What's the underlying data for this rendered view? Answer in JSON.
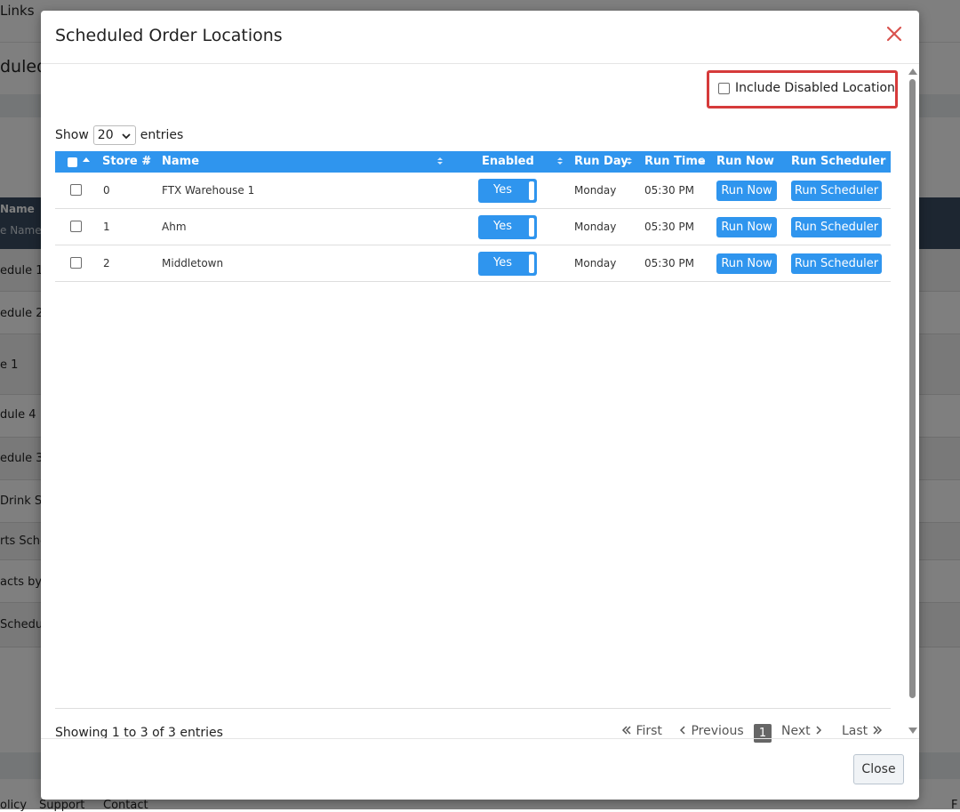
{
  "background": {
    "nav_link": "Links",
    "heading_fragment": "duled",
    "col_header": "Name",
    "filter_placeholder": "e Name",
    "rows": [
      "edule 1",
      "edule 2",
      "e 1",
      "dule 4",
      "edule 3",
      "Drink Sche",
      "rts Sche",
      "acts by A",
      "Schedul"
    ],
    "footer_links": [
      "olicy",
      "Support",
      "Contact"
    ],
    "footer_right": "F"
  },
  "modal": {
    "title": "Scheduled Order Locations",
    "include_disabled_label": "Include Disabled Location",
    "include_disabled_checked": false,
    "show_label": "Show",
    "entries_value": "20",
    "entries_label": "entries",
    "columns": {
      "store": "Store #",
      "name": "Name",
      "enabled": "Enabled",
      "run_day": "Run Day",
      "run_time": "Run Time",
      "run_now": "Run Now",
      "run_scheduler": "Run Scheduler"
    },
    "rows": [
      {
        "store": "0",
        "name": "FTX Warehouse 1",
        "enabled": "Yes",
        "run_day": "Monday",
        "run_time": "05:30 PM",
        "run_now": "Run Now",
        "run_scheduler": "Run Scheduler"
      },
      {
        "store": "1",
        "name": "Ahm",
        "enabled": "Yes",
        "run_day": "Monday",
        "run_time": "05:30 PM",
        "run_now": "Run Now",
        "run_scheduler": "Run Scheduler"
      },
      {
        "store": "2",
        "name": "Middletown",
        "enabled": "Yes",
        "run_day": "Monday",
        "run_time": "05:30 PM",
        "run_now": "Run Now",
        "run_scheduler": "Run Scheduler"
      }
    ],
    "info": "Showing 1 to 3 of 3 entries",
    "pagination": {
      "first": "First",
      "previous": "Previous",
      "current_page": "1",
      "next": "Next",
      "last": "Last"
    },
    "close_label": "Close"
  },
  "colors": {
    "accent": "#2f95ee",
    "highlight_border": "#d63b3b",
    "close_icon": "#d9534f"
  },
  "icons": [
    "close-icon",
    "sort-icon",
    "double-chevron-left-icon",
    "chevron-left-icon",
    "chevron-right-icon",
    "double-chevron-right-icon",
    "scroll-up-arrow-icon",
    "scroll-down-arrow-icon"
  ]
}
